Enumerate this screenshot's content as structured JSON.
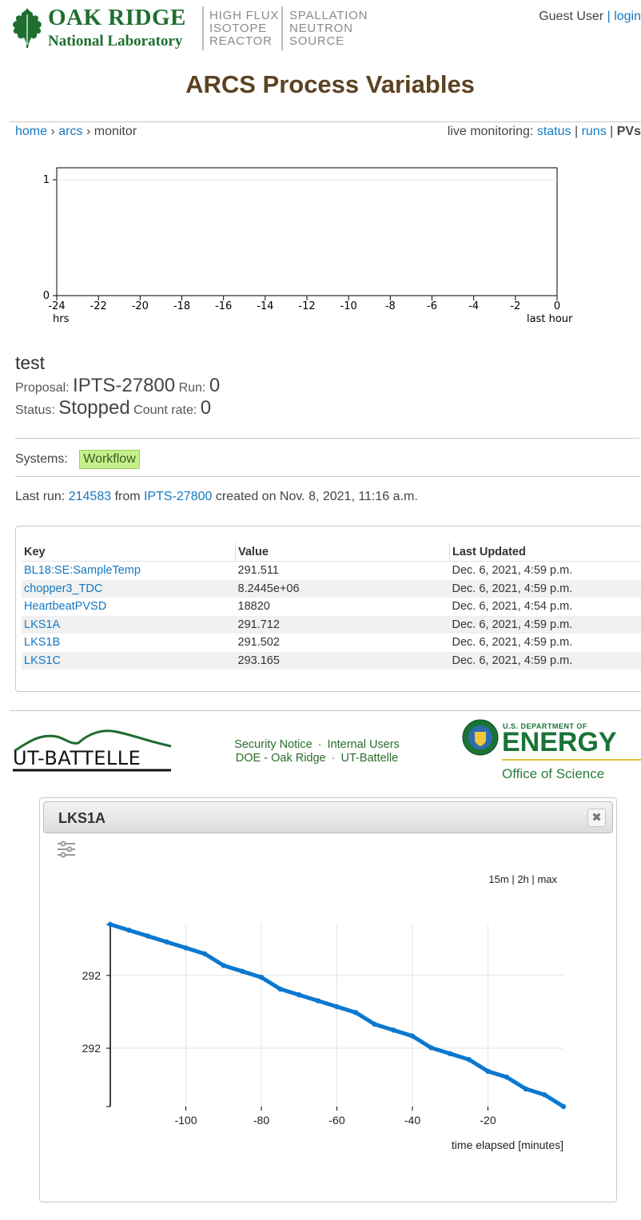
{
  "header": {
    "org_line1": "Oak Ridge",
    "org_line2": "National Laboratory",
    "facility1": [
      "HIGH FLUX",
      "ISOTOPE",
      "REACTOR"
    ],
    "facility2": [
      "SPALLATION",
      "NEUTRON",
      "SOURCE"
    ],
    "user": "Guest User",
    "user_sep": "|",
    "login_label": "login"
  },
  "page_title": "ARCS Process Variables",
  "breadcrumb": {
    "home": "home",
    "sep1": "›",
    "instrument": "arcs",
    "sep2": "›",
    "current": "monitor"
  },
  "live_monitoring": {
    "label": "live monitoring:",
    "status": "status",
    "sep1": "|",
    "runs": "runs",
    "sep2": "|",
    "pvs": "PVs"
  },
  "run_chart": {
    "y_ticks": [
      "1",
      "0"
    ],
    "x_ticks": [
      "-24",
      "-22",
      "-20",
      "-18",
      "-16",
      "-14",
      "-12",
      "-10",
      "-8",
      "-6",
      "-4",
      "-2",
      "0"
    ],
    "x_left_label": "hrs",
    "x_right_label": "last hour"
  },
  "run_info": {
    "title": "test",
    "proposal_label": "Proposal:",
    "proposal_value": "IPTS-27800",
    "run_label": "Run:",
    "run_value": "0",
    "status_label": "Status:",
    "status_value": "Stopped",
    "count_rate_label": "Count rate:",
    "count_rate_value": "0",
    "systems_label": "Systems:",
    "workflow_badge": "Workflow"
  },
  "last_run": {
    "prefix": "Last run:",
    "run_number": "214583",
    "from": "from",
    "proposal": "IPTS-27800",
    "created": "created on Nov. 8, 2021, 11:16 a.m."
  },
  "pv_table": {
    "headers": [
      "Key",
      "Value",
      "Last Updated"
    ],
    "rows": [
      [
        "BL18:SE:SampleTemp",
        "291.511",
        "Dec. 6, 2021, 4:59 p.m."
      ],
      [
        "chopper3_TDC",
        "8.2445e+06",
        "Dec. 6, 2021, 4:59 p.m."
      ],
      [
        "HeartbeatPVSD",
        "18820",
        "Dec. 6, 2021, 4:54 p.m."
      ],
      [
        "LKS1A",
        "291.712",
        "Dec. 6, 2021, 4:59 p.m."
      ],
      [
        "LKS1B",
        "291.502",
        "Dec. 6, 2021, 4:59 p.m."
      ],
      [
        "LKS1C",
        "293.165",
        "Dec. 6, 2021, 4:59 p.m."
      ]
    ]
  },
  "footer": {
    "ut_battelle_logo_text": "UT-BATTELLE",
    "links": [
      "Security Notice",
      "Internal Users",
      "DOE - Oak Ridge",
      "UT-Battelle"
    ],
    "dot": "·",
    "doe_small": "U.S. DEPARTMENT OF",
    "doe_word": "ENERGY",
    "doe_office": "Office of Science"
  },
  "dialog": {
    "title": "LKS1A",
    "close_icon": "close-icon",
    "settings_icon": "sliders-icon",
    "ranges": [
      "15m",
      "2h",
      "max"
    ],
    "range_sep": "|"
  },
  "chart_data": {
    "type": "line",
    "title": "",
    "xlabel": "time elapsed [minutes]",
    "ylabel": "",
    "xlim": [
      -120,
      0
    ],
    "x_ticks": [
      -100,
      -80,
      -60,
      -40,
      -20
    ],
    "y_tick_labels": [
      "292",
      "292"
    ],
    "grid": true,
    "color": "#0b78d0",
    "series": [
      {
        "x": [
          -120,
          -115,
          -110,
          -105,
          -100,
          -95,
          -90,
          -85,
          -80,
          -75,
          -70,
          -65,
          -60,
          -55,
          -50,
          -45,
          -40,
          -35,
          -30,
          -25,
          -20,
          -15,
          -10,
          -5,
          0
        ],
        "values": [
          292.24,
          292.23,
          292.22,
          292.21,
          292.2,
          292.19,
          292.17,
          292.16,
          292.15,
          292.13,
          292.12,
          292.11,
          292.1,
          292.09,
          292.07,
          292.06,
          292.05,
          292.03,
          292.02,
          292.01,
          291.99,
          291.98,
          291.96,
          291.95,
          291.93
        ]
      }
    ]
  }
}
